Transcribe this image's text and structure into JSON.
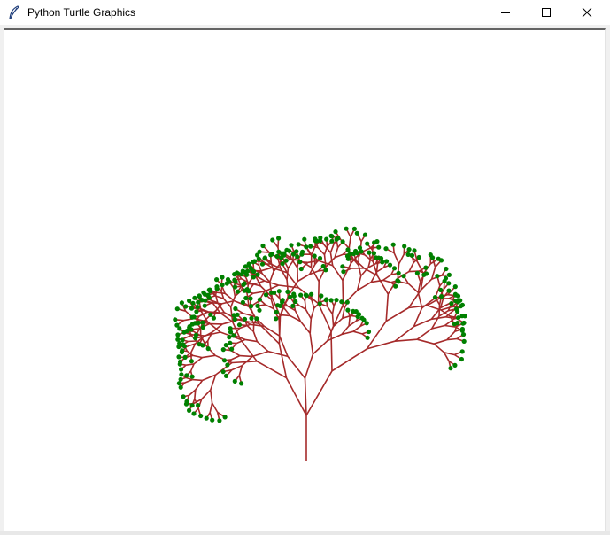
{
  "window": {
    "title": "Python Turtle Graphics",
    "icon": "feather-icon",
    "controls": [
      "minimize-icon",
      "maximize-icon",
      "close-icon"
    ]
  },
  "canvas": {
    "background_color": "#ffffff",
    "drawing": "fractal-tree",
    "colors": {
      "branch": "#a52a2a",
      "leaf": "#008000"
    }
  }
}
